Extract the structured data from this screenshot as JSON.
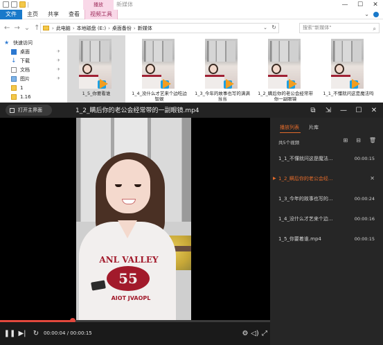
{
  "explorer": {
    "title": "新媒体",
    "contextual_tab_group": "播放",
    "ribbon_tabs": [
      "文件",
      "主页",
      "共享",
      "查看",
      "视频工具"
    ],
    "address_crumbs": [
      "此电脑",
      "本地磁盘 (E:)",
      "桌面备份",
      "新媒体"
    ],
    "search_placeholder": "搜索\"新媒体\"",
    "nav_items": [
      {
        "label": "快速访问",
        "icon": "star-icon"
      },
      {
        "label": "桌面",
        "icon": "desktop-icon"
      },
      {
        "label": "下载",
        "icon": "download-icon"
      },
      {
        "label": "文档",
        "icon": "document-icon"
      },
      {
        "label": "图片",
        "icon": "picture-icon"
      },
      {
        "label": "1",
        "icon": "folder-icon"
      },
      {
        "label": "1.16",
        "icon": "folder-icon"
      }
    ],
    "files": [
      {
        "name": "1_5_你要看谁",
        "selected": true
      },
      {
        "name": "1_4_没什么才艺来个边吃边智娱",
        "selected": false
      },
      {
        "name": "1_3_今年的故事也写的满满当当",
        "selected": false
      },
      {
        "name": "1_2_瞒后你的老公会经常带你一副眼镜",
        "selected": false
      },
      {
        "name": "1_1_不懂就问这是魔法吗",
        "selected": false
      }
    ]
  },
  "player": {
    "open_home_label": "打开主界面",
    "current_file": "1_2_瞒后你的老公会经常带的一副眼镜.mp4",
    "time_current": "00:00:04",
    "time_total": "00:00:15",
    "progress_fraction": 0.27,
    "playlist": {
      "tab_active": "播放列表",
      "tab_other": "片库",
      "count_text": "共5个视频",
      "items": [
        {
          "name": "1_1_不懂就问这是魔法...",
          "duration": "00:00:15",
          "active": false
        },
        {
          "name": "1_2_瞒后你的老公会经...",
          "duration": "",
          "active": true
        },
        {
          "name": "1_3_今年的故事也写的...",
          "duration": "00:00:24",
          "active": false
        },
        {
          "name": "1_4_没什么才艺来个边...",
          "duration": "00:00:16",
          "active": false
        },
        {
          "name": "1_5_你要着谁.mp4",
          "duration": "00:00:15",
          "active": false
        }
      ]
    },
    "jersey_text": "ANL VALLEY",
    "jersey_number": "55",
    "jersey_sub": "AIOT JVAOPL",
    "colors": {
      "accent": "#e46b2a",
      "progress": "#e2483d"
    }
  }
}
